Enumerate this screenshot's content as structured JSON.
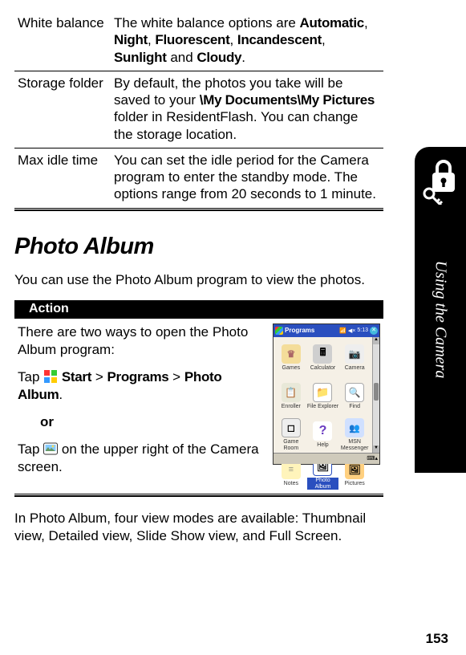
{
  "options": [
    {
      "name": "White balance",
      "desc_pre": "The white balance options are ",
      "terms": [
        "Automatic",
        "Night",
        "Fluorescent",
        "Incandescent",
        "Sunlight"
      ],
      "joiner_last": " and ",
      "last_term": "Cloudy",
      "desc_post": "."
    },
    {
      "name": "Storage folder",
      "desc_pre": "By default, the photos you take will be saved to your ",
      "path_term": "\\My Documents\\My Pictures",
      "desc_post": " folder in ResidentFlash. You can change the storage location."
    },
    {
      "name": "Max idle time",
      "desc": "You can set the idle period for the Camera program to enter the standby mode. The options range from 20 seconds to 1 minute."
    }
  ],
  "section_title": "Photo Album",
  "intro_para": "You can use the Photo Album program to view the photos.",
  "action_header": "Action",
  "action": {
    "p1": "There are two ways to open the Photo Album program:",
    "tap_label": "Tap ",
    "start_term": "Start",
    "gt": " > ",
    "programs_term": "Programs",
    "album_term": "Photo Album",
    "period": ".",
    "or": "or",
    "p3_pre": "Tap ",
    "p3_post": " on the upper right of the Camera screen."
  },
  "mini": {
    "title": "Programs",
    "time": "5:13",
    "items": [
      {
        "label": "Games",
        "cls": "ico-games"
      },
      {
        "label": "Calculator",
        "cls": "ico-calc"
      },
      {
        "label": "Camera",
        "cls": "ico-cam"
      },
      {
        "label": "Enroller",
        "cls": "ico-enroll"
      },
      {
        "label": "File Explorer",
        "cls": "ico-file"
      },
      {
        "label": "Find",
        "cls": "ico-find"
      },
      {
        "label": "Game Room",
        "cls": "ico-gameroom"
      },
      {
        "label": "Help",
        "cls": "ico-help"
      },
      {
        "label": "MSN Messenger",
        "cls": "ico-msn"
      },
      {
        "label": "Notes",
        "cls": "ico-notes"
      },
      {
        "label": "Photo Album",
        "cls": "ico-album",
        "sel": true
      },
      {
        "label": "Pictures",
        "cls": "ico-pics"
      }
    ]
  },
  "closing_para": "In Photo Album, four view modes are available: Thumbnail view, Detailed view, Slide Show view, and Full Screen.",
  "side_tab": "Using the Camera",
  "page_number": "153"
}
